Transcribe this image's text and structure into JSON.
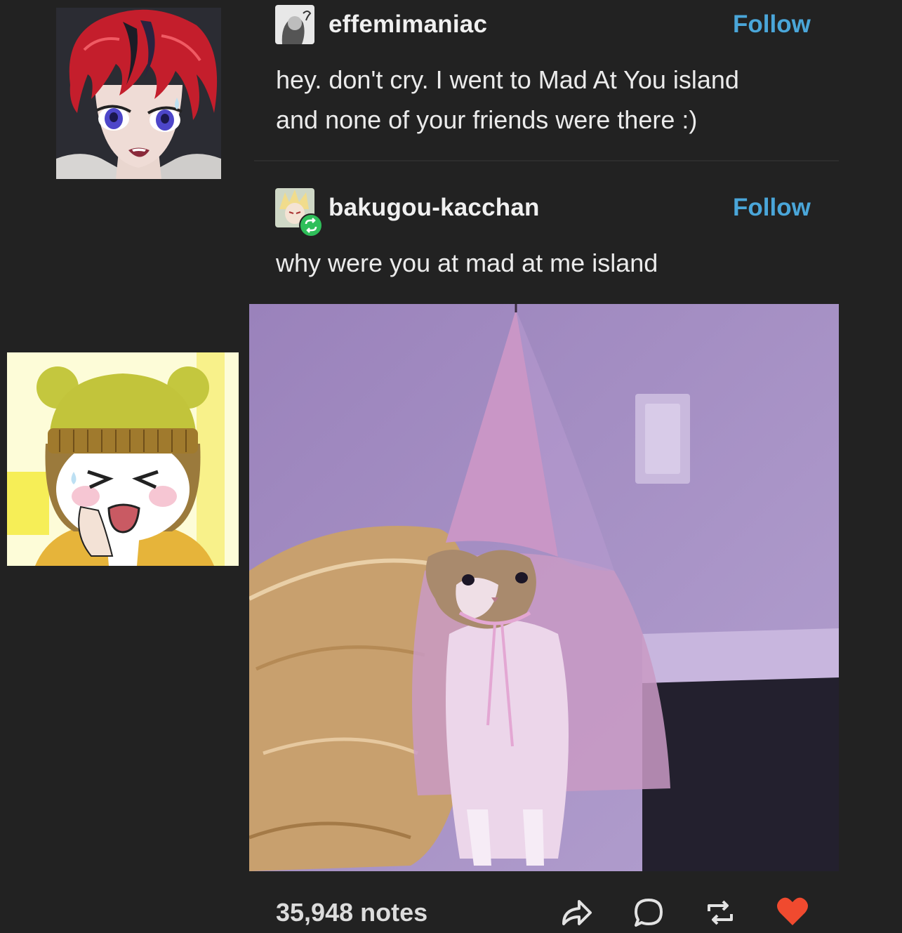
{
  "post": {
    "first_reply": {
      "username": "effemimaniac",
      "follow_label": "Follow",
      "text_line1": "hey. don't cry. I went to Mad At You island",
      "text_line2": "and none of your friends were there :)"
    },
    "second_reply": {
      "username": "bakugou-kacchan",
      "follow_label": "Follow",
      "text": "why were you at mad at me island"
    },
    "footer": {
      "notes": "35,948 notes",
      "icons": [
        "share-icon",
        "reply-icon",
        "reblog-icon",
        "like-heart-icon"
      ]
    }
  },
  "colors": {
    "background": "#222222",
    "follow_link": "#4aa6d9",
    "like_heart": "#f04a2f",
    "reblog_badge": "#2fbf5a"
  }
}
